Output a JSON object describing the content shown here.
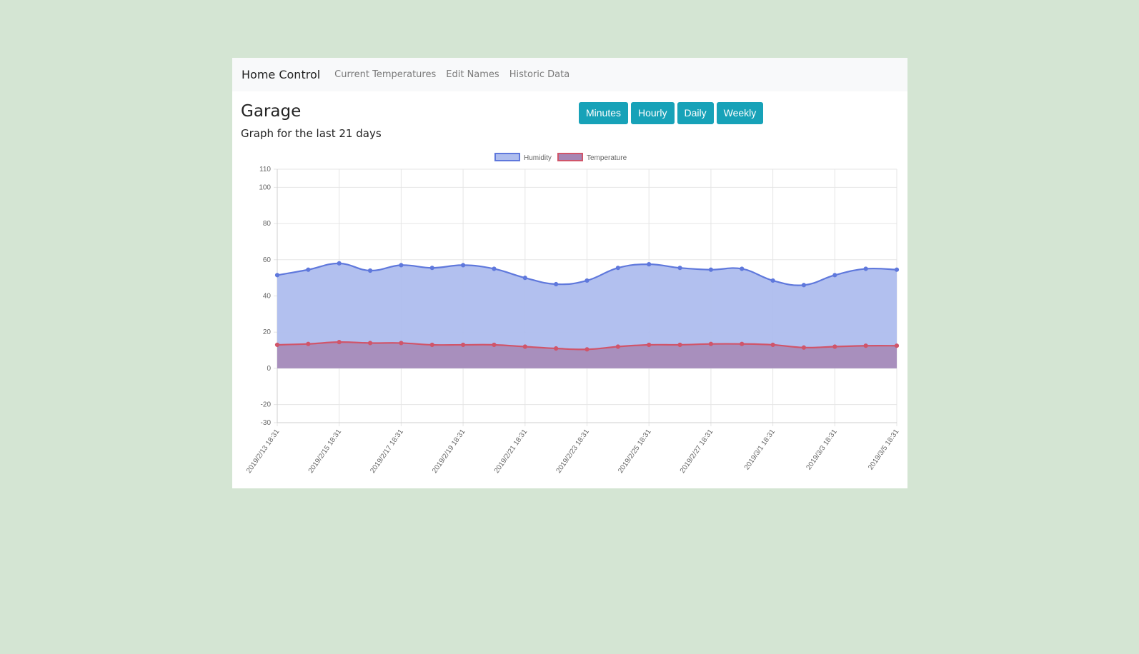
{
  "navbar": {
    "brand": "Home Control",
    "links": [
      "Current Temperatures",
      "Edit Names",
      "Historic Data"
    ]
  },
  "page": {
    "title": "Garage",
    "subtitle": "Graph for the last 21 days"
  },
  "range_buttons": [
    "Minutes",
    "Hourly",
    "Daily",
    "Weekly"
  ],
  "colors": {
    "accent": "#17a2b8",
    "humidity_line": "#5f78dc",
    "humidity_fill": "#aebdee",
    "temperature_line": "#d0556a",
    "temperature_fill": "#a686b4"
  },
  "chart_data": {
    "type": "area",
    "y_ticks": [
      110,
      100,
      80,
      60,
      40,
      20,
      0,
      -20,
      -30
    ],
    "ylim": [
      -30,
      110
    ],
    "x_labels": [
      "2019/2/13 18:31",
      "2019/2/15 18:31",
      "2019/2/17 18:31",
      "2019/2/19 18:31",
      "2019/2/21 18:31",
      "2019/2/23 18:31",
      "2019/2/25 18:31",
      "2019/2/27 18:31",
      "2019/3/1 18:31",
      "2019/3/3 18:31",
      "2019/3/5 18:31"
    ],
    "x": [
      "2019/2/13 18:31",
      "2019/2/14 18:31",
      "2019/2/15 18:31",
      "2019/2/16 18:31",
      "2019/2/17 18:31",
      "2019/2/18 18:31",
      "2019/2/19 18:31",
      "2019/2/20 18:31",
      "2019/2/21 18:31",
      "2019/2/22 18:31",
      "2019/2/23 18:31",
      "2019/2/24 18:31",
      "2019/2/25 18:31",
      "2019/2/26 18:31",
      "2019/2/27 18:31",
      "2019/2/28 18:31",
      "2019/3/1 18:31",
      "2019/3/2 18:31",
      "2019/3/3 18:31",
      "2019/3/4 18:31",
      "2019/3/5 18:31"
    ],
    "grid": true,
    "legend_position": "top",
    "series": [
      {
        "name": "Humidity",
        "values": [
          51.5,
          54.5,
          58,
          54,
          57,
          55.5,
          57,
          55,
          50,
          46.5,
          48.5,
          55.5,
          57.5,
          55.5,
          54.5,
          55,
          48.5,
          46,
          51.5,
          55,
          54.5
        ]
      },
      {
        "name": "Temperature",
        "values": [
          13,
          13.5,
          14.5,
          14,
          14,
          13,
          13,
          13,
          12,
          11,
          10.5,
          12,
          13,
          13,
          13.5,
          13.5,
          13,
          11.5,
          12,
          12.5,
          12.5
        ]
      }
    ]
  }
}
